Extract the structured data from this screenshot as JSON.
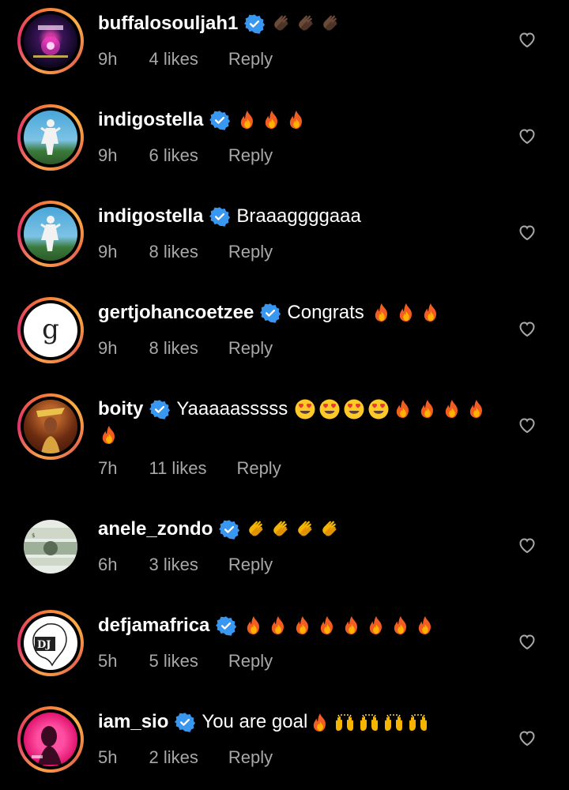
{
  "colors": {
    "background": "#000000",
    "text": "#ffffff",
    "meta": "#a8a8a8",
    "verified": "#3897f0"
  },
  "comments": [
    {
      "username": "buffalosouljah1",
      "text": "",
      "emojis": "clap-dark x3",
      "time": "9h",
      "likes": "4 likes",
      "reply": "Reply",
      "avatar": "unity-album-art"
    },
    {
      "username": "indigostella",
      "text": "",
      "emojis": "fire x3",
      "time": "9h",
      "likes": "6 likes",
      "reply": "Reply",
      "avatar": "figure-on-blue"
    },
    {
      "username": "indigostella",
      "text": "Braaaggggaaa",
      "emojis": "",
      "time": "9h",
      "likes": "8 likes",
      "reply": "Reply",
      "avatar": "figure-on-blue"
    },
    {
      "username": "gertjohancoetzee",
      "text": "Congrats",
      "emojis": "fire x3",
      "time": "9h",
      "likes": "8 likes",
      "reply": "Reply",
      "avatar": "letter-g"
    },
    {
      "username": "boity",
      "text": "Yaaaaasssss",
      "emojis": "heart-eyes x4, fire x5",
      "time": "7h",
      "likes": "11 likes",
      "reply": "Reply",
      "avatar": "woman-portrait"
    },
    {
      "username": "anele_zondo",
      "text": "",
      "emojis": "clap-yellow x4",
      "time": "6h",
      "likes": "3 likes",
      "reply": "Reply",
      "avatar": "banknote"
    },
    {
      "username": "defjamafrica",
      "text": "",
      "emojis": "fire x8",
      "time": "5h",
      "likes": "5 likes",
      "reply": "Reply",
      "avatar": "def-jam-logo"
    },
    {
      "username": "iam_sio",
      "text": "You are goal",
      "emojis": "fire x1, raised-hands x4",
      "time": "5h",
      "likes": "2 likes",
      "reply": "Reply",
      "avatar": "pink-portrait"
    }
  ],
  "icons": {
    "verified": "verified-badge-icon",
    "heart": "heart-outline-icon"
  }
}
